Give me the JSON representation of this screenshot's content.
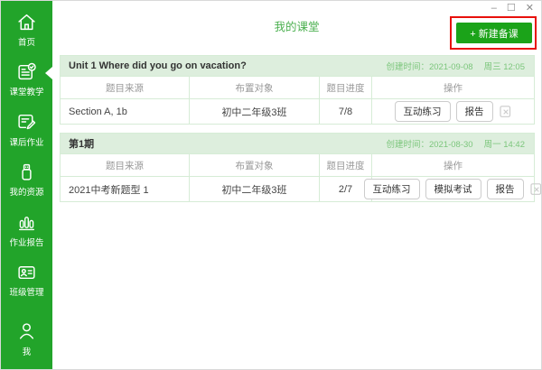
{
  "window": {
    "controls": {
      "minimize": "–",
      "maximize": "☐",
      "close": "✕"
    }
  },
  "header": {
    "title": "我的课堂",
    "new_button_label": "+ 新建备课"
  },
  "sidebar": {
    "items": [
      {
        "label": "首页",
        "icon": "home-icon",
        "active": false
      },
      {
        "label": "课堂教学",
        "icon": "classroom-icon",
        "active": true
      },
      {
        "label": "课后作业",
        "icon": "homework-icon",
        "active": false
      },
      {
        "label": "我的资源",
        "icon": "resources-icon",
        "active": false
      },
      {
        "label": "作业报告",
        "icon": "report-icon",
        "active": false
      },
      {
        "label": "班级管理",
        "icon": "class-manage-icon",
        "active": false
      },
      {
        "label": "我",
        "icon": "me-icon",
        "active": false
      }
    ]
  },
  "table_headers": [
    "题目来源",
    "布置对象",
    "题目进度",
    "操作"
  ],
  "sections": [
    {
      "title": "Unit 1 Where did you go on vacation?",
      "created_text": "创建时间：2021-09-08",
      "weekday_time": "周三 12:05",
      "rows": [
        {
          "source": "Section A, 1b",
          "target": "初中二年级3班",
          "progress": "7/8",
          "actions": [
            "互动练习",
            "报告"
          ]
        }
      ]
    },
    {
      "title": "第1期",
      "created_text": "创建时间：2021-08-30",
      "weekday_time": "周一 14:42",
      "rows": [
        {
          "source": "2021中考新题型 1",
          "target": "初中二年级3班",
          "progress": "2/7",
          "actions": [
            "互动练习",
            "模拟考试",
            "报告"
          ]
        }
      ]
    }
  ],
  "colors": {
    "accent_green": "#22a42a",
    "button_green": "#1ba319",
    "section_header_bg": "#ddeedd",
    "table_border_green": "#d6ecd6",
    "title_green": "#4cb050",
    "time_text_green": "#7cc67c",
    "annotation_red": "#e8100c"
  }
}
